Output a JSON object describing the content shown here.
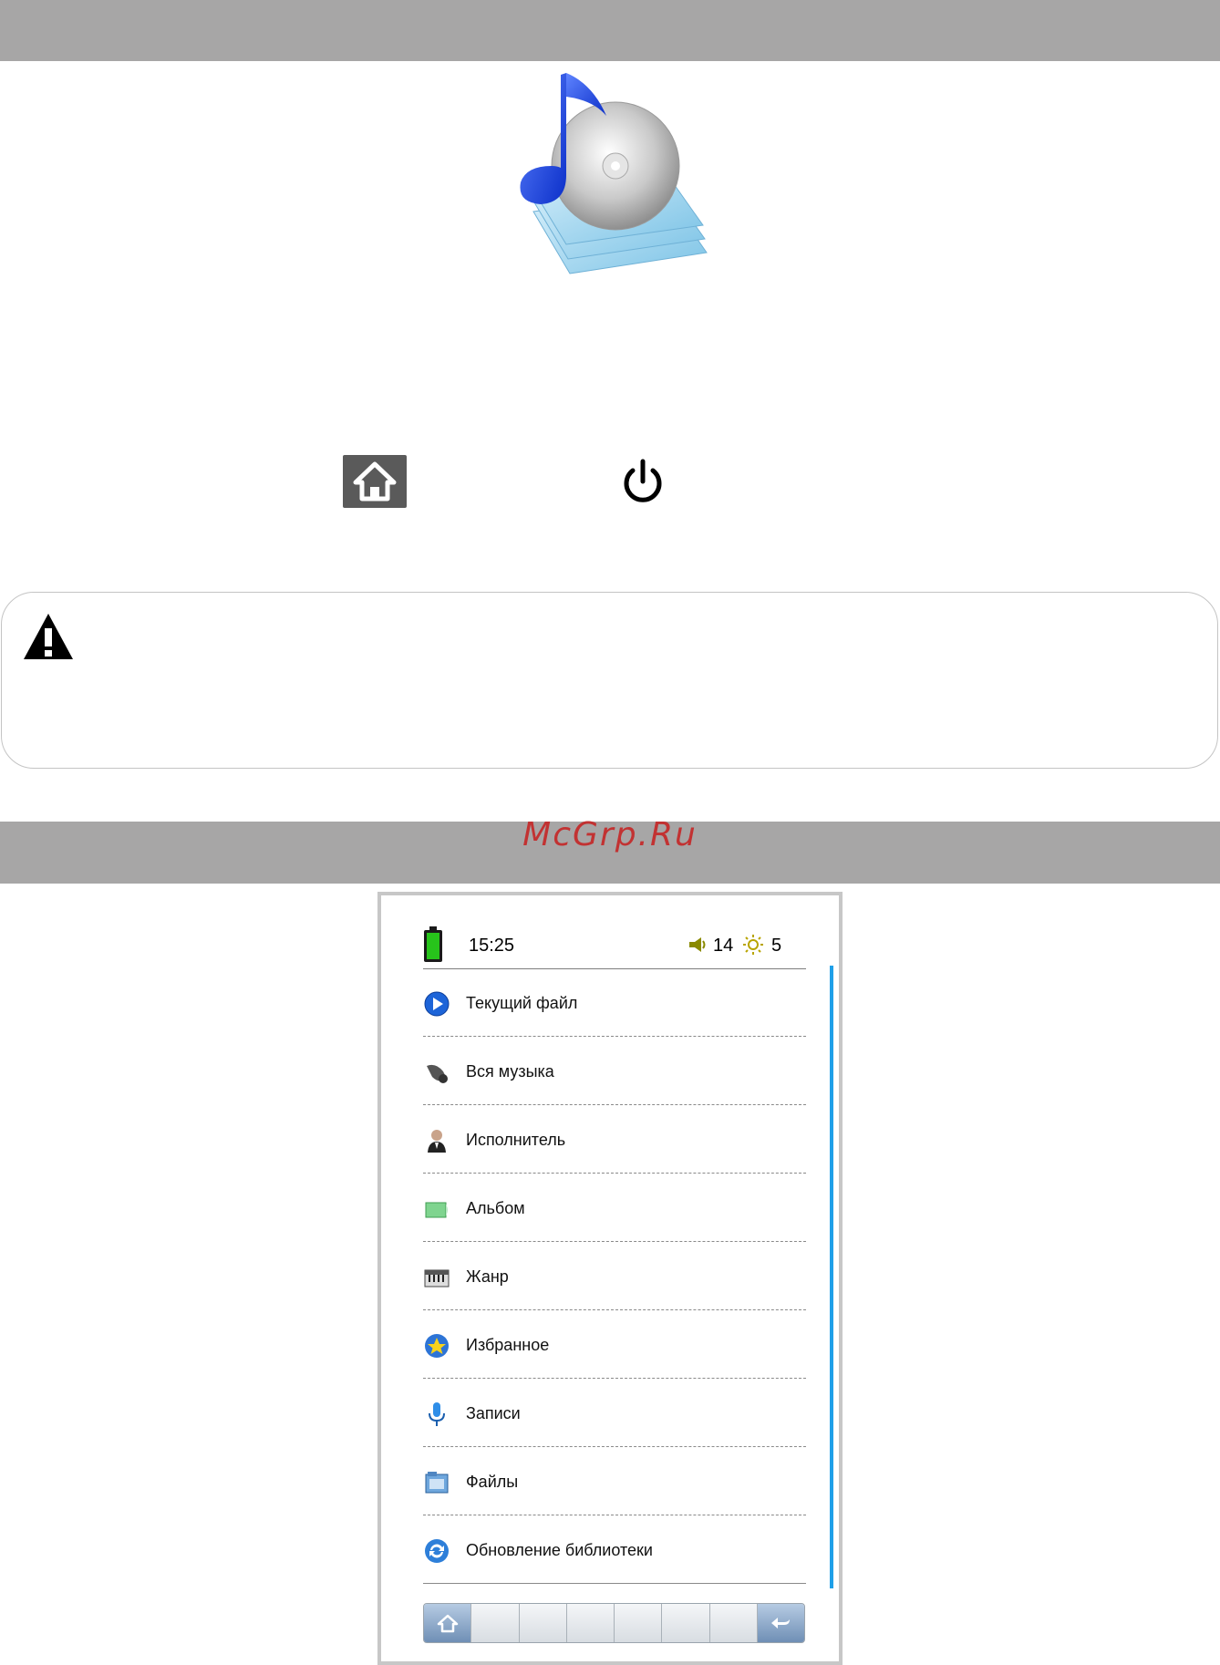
{
  "page": {
    "keys": {
      "home_icon": "home-icon",
      "power_icon": "power-icon"
    },
    "warning": {
      "icon": "warning-icon"
    },
    "watermark": "McGrp.Ru"
  },
  "device": {
    "status": {
      "battery_icon": "battery-icon",
      "battery_color": "#27c41b",
      "time": "15:25",
      "volume": "14",
      "brightness": "5"
    },
    "menu": [
      {
        "label": "Текущий файл",
        "icon": "play-icon"
      },
      {
        "label": "Вся музыка",
        "icon": "music-icon"
      },
      {
        "label": "Исполнитель",
        "icon": "artist-icon"
      },
      {
        "label": "Альбом",
        "icon": "album-icon"
      },
      {
        "label": "Жанр",
        "icon": "genre-icon"
      },
      {
        "label": "Избранное",
        "icon": "favorites-icon"
      },
      {
        "label": "Записи",
        "icon": "microphone-icon"
      },
      {
        "label": "Файлы",
        "icon": "files-icon"
      },
      {
        "label": "Обновление библиотеки",
        "icon": "refresh-icon"
      }
    ],
    "bottom_bar": {
      "home_icon": "home-icon",
      "back_icon": "back-icon"
    },
    "accent_color": "#1e9fe8"
  }
}
